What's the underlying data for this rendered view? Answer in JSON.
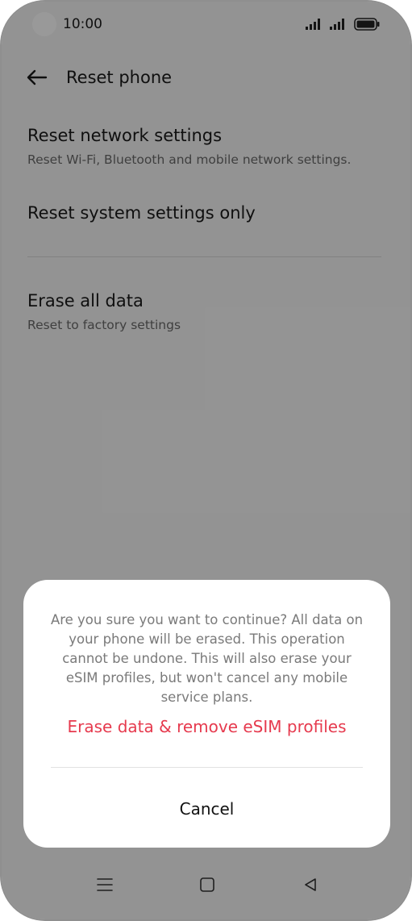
{
  "status_bar": {
    "time": "10:00"
  },
  "header": {
    "title": "Reset phone",
    "back_icon": "arrow-left-icon"
  },
  "items": [
    {
      "title": "Reset network settings",
      "subtitle": "Reset Wi-Fi, Bluetooth and mobile network settings."
    },
    {
      "title": "Reset system settings only",
      "subtitle": ""
    },
    {
      "title": "Erase all data",
      "subtitle": "Reset to factory settings"
    }
  ],
  "dialog": {
    "message": "Are you sure you want to continue? All data on your phone will be erased. This operation cannot be undone. This will also erase your eSIM profiles, but won't cancel any mobile service plans.",
    "confirm_label": "Erase data & remove eSIM profiles",
    "cancel_label": "Cancel",
    "confirm_color": "#e63a4e"
  },
  "nav_bar": {
    "icons": [
      "menu-icon",
      "home-icon",
      "back-triangle-icon"
    ]
  }
}
